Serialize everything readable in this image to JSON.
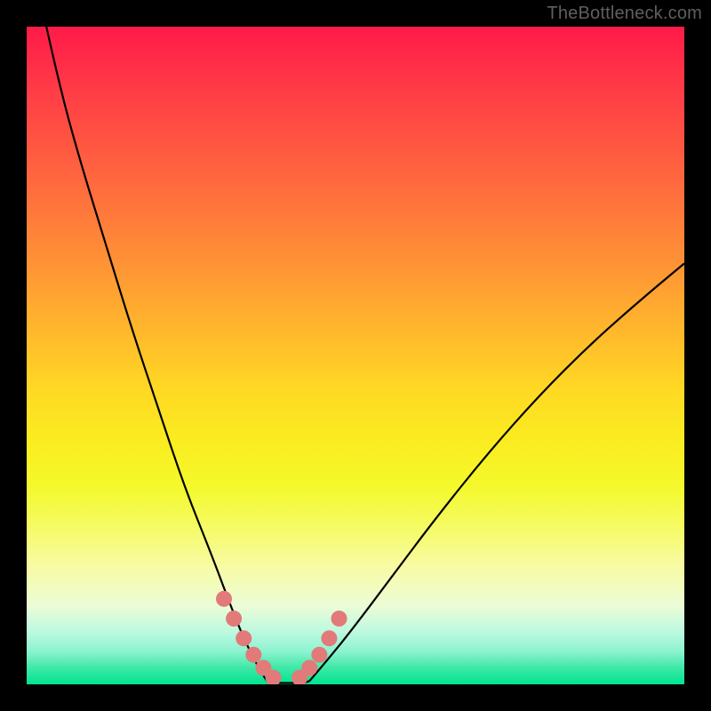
{
  "watermark": "TheBottleneck.com",
  "chart_data": {
    "type": "line",
    "title": "",
    "xlabel": "",
    "ylabel": "",
    "xlim": [
      0,
      100
    ],
    "ylim": [
      0,
      100
    ],
    "grid": false,
    "legend": false,
    "background_gradient": {
      "top": "#ff1a49",
      "mid": "#ffd824",
      "bottom": "#00e48f"
    },
    "series": [
      {
        "name": "left-curve",
        "color": "#000000",
        "x": [
          3,
          5,
          8,
          12,
          16,
          20,
          24,
          28,
          31,
          33,
          35,
          36.5
        ],
        "y": [
          100,
          91,
          80,
          67,
          54,
          42,
          30,
          20,
          12,
          7,
          3,
          0.5
        ]
      },
      {
        "name": "right-curve",
        "color": "#000000",
        "x": [
          43,
          46,
          50,
          56,
          62,
          70,
          78,
          86,
          94,
          100
        ],
        "y": [
          0.5,
          4,
          9,
          17,
          25,
          35,
          44,
          52,
          59,
          64
        ]
      },
      {
        "name": "valley-floor",
        "color": "#000000",
        "x": [
          36.5,
          38,
          40,
          42,
          43
        ],
        "y": [
          0.5,
          0.2,
          0.2,
          0.2,
          0.5
        ]
      },
      {
        "name": "highlight-points",
        "type": "scatter",
        "color": "#e27a7a",
        "x": [
          30,
          31.5,
          33,
          34.5,
          36,
          37.5,
          41.5,
          43,
          44.5,
          46,
          47.5
        ],
        "y": [
          13,
          10,
          7,
          4.5,
          2.5,
          1,
          1,
          2.5,
          4.5,
          7,
          10
        ]
      }
    ]
  }
}
